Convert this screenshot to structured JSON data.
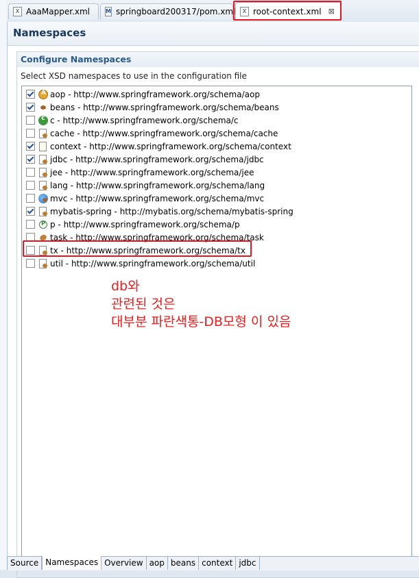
{
  "editor_tabs": [
    {
      "label": "AaaMapper.xml",
      "icon": "xml-file-icon"
    },
    {
      "label": "springboard200317/pom.xml",
      "icon": "maven-file-icon"
    },
    {
      "label": "root-context.xml",
      "icon": "xml-file-icon",
      "active": true,
      "close": "⊠"
    }
  ],
  "page_title": "Namespaces",
  "section": {
    "title": "Configure Namespaces",
    "description": "Select XSD namespaces to use in the configuration file"
  },
  "namespaces": [
    {
      "label": "aop - http://www.springframework.org/schema/aop",
      "checked": true,
      "icon": "aop-icon"
    },
    {
      "label": "beans - http://www.springframework.org/schema/beans",
      "checked": true,
      "icon": "bean-icon"
    },
    {
      "label": "c - http://www.springframework.org/schema/c",
      "checked": false,
      "icon": "c-namespace-icon"
    },
    {
      "label": "cache - http://www.springframework.org/schema/cache",
      "checked": false,
      "icon": "cache-icon"
    },
    {
      "label": "context - http://www.springframework.org/schema/context",
      "checked": true,
      "icon": "context-icon"
    },
    {
      "label": "jdbc - http://www.springframework.org/schema/jdbc",
      "checked": true,
      "icon": "jdbc-icon"
    },
    {
      "label": "jee - http://www.springframework.org/schema/jee",
      "checked": false,
      "icon": "jee-icon"
    },
    {
      "label": "lang - http://www.springframework.org/schema/lang",
      "checked": false,
      "icon": "lang-icon"
    },
    {
      "label": "mvc - http://www.springframework.org/schema/mvc",
      "checked": false,
      "icon": "mvc-globe-icon"
    },
    {
      "label": "mybatis-spring - http://mybatis.org/schema/mybatis-spring",
      "checked": true,
      "icon": "mybatis-icon"
    },
    {
      "label": "p - http://www.springframework.org/schema/p",
      "checked": false,
      "icon": "p-namespace-icon"
    },
    {
      "label": "task - http://www.springframework.org/schema/task",
      "checked": false,
      "icon": "task-icon"
    },
    {
      "label": "tx - http://www.springframework.org/schema/tx",
      "checked": false,
      "icon": "tx-icon"
    },
    {
      "label": "util - http://www.springframework.org/schema/util",
      "checked": false,
      "icon": "util-icon"
    }
  ],
  "annotation": {
    "line1": "db와",
    "line2": "관련된 것은",
    "line3": "대부분 파란색통-DB모형 이 있음",
    "color": "#ee1c1c"
  },
  "bottom_tabs": [
    "Source",
    "Namespaces",
    "Overview",
    "aop",
    "beans",
    "context",
    "jdbc"
  ],
  "bottom_active": "Namespaces",
  "highlight_color": "#e8141e"
}
